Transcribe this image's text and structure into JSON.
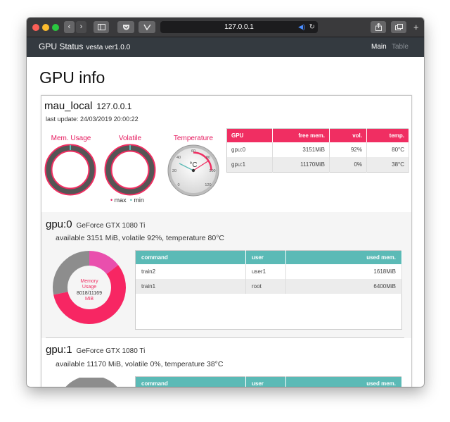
{
  "browser": {
    "url": "127.0.0.1"
  },
  "navbar": {
    "title": "GPU Status",
    "version": "vesta ver1.0.0",
    "links": [
      {
        "label": "Main",
        "active": true
      },
      {
        "label": "Table",
        "active": false
      }
    ]
  },
  "page": {
    "title": "GPU info"
  },
  "host": {
    "name": "mau_local",
    "ip": "127.0.0.1",
    "last_update": "last update: 24/03/2019 20:00:22",
    "gauges": {
      "mem_label": "Mem. Usage",
      "volatile_label": "Volatile",
      "temp_label": "Temperature",
      "temp_unit": "°C",
      "temp_ticks": [
        "0",
        "20",
        "40",
        "60",
        "80",
        "100",
        "120"
      ],
      "legend_max": "max",
      "legend_min": "min"
    },
    "summary_table": {
      "headers": [
        "GPU",
        "free mem.",
        "vol.",
        "temp."
      ],
      "rows": [
        [
          "gpu:0",
          "3151MiB",
          "92%",
          "80°C"
        ],
        [
          "gpu:1",
          "11170MiB",
          "0%",
          "38°C"
        ]
      ]
    }
  },
  "gpus": [
    {
      "name": "gpu:0",
      "model": "GeForce GTX 1080 Ti",
      "summary": "available 3151 MiB, volatile 92%, temperature 80°C",
      "donut_title_1": "Memory",
      "donut_title_2": "Usage",
      "donut_value": "8018/11169",
      "donut_unit": "MiB",
      "donut_segments": [
        {
          "label": "train2",
          "value": 1618,
          "color": "#e94fad"
        },
        {
          "label": "train1",
          "value": 6400,
          "color": "#f72663"
        },
        {
          "label": "free",
          "value": 3151,
          "color": "#8d8d8d"
        }
      ],
      "process_table": {
        "headers": [
          "command",
          "user",
          "used mem."
        ],
        "rows": [
          [
            "train2",
            "user1",
            "1618MiB"
          ],
          [
            "train1",
            "root",
            "6400MiB"
          ]
        ]
      }
    },
    {
      "name": "gpu:1",
      "model": "GeForce GTX 1080 Ti",
      "summary": "available 11170 MiB, volatile 0%, temperature 38°C",
      "process_table": {
        "headers": [
          "command",
          "user",
          "used mem."
        ]
      }
    }
  ],
  "colors": {
    "accent_pink": "#f02e62",
    "accent_teal": "#5bbab6",
    "navbar_bg": "#343a40"
  }
}
